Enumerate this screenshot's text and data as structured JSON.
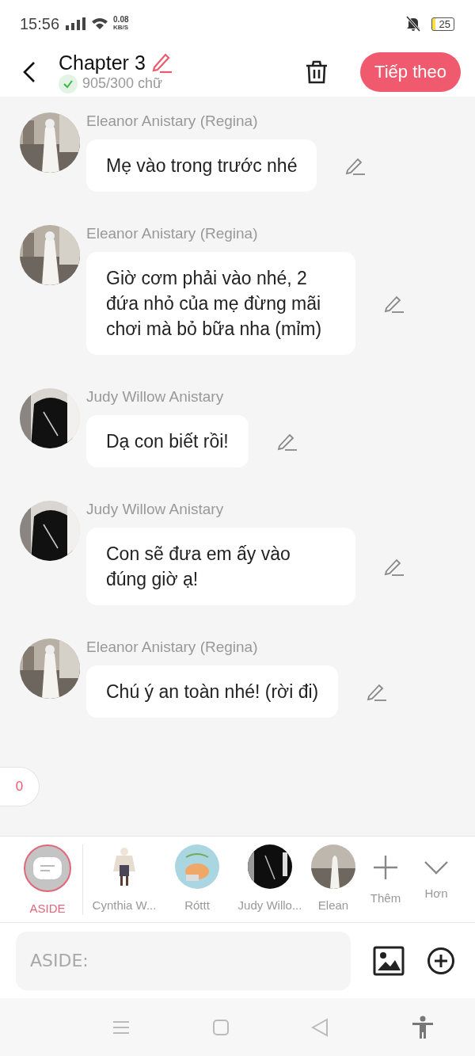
{
  "status_bar": {
    "time": "15:56",
    "speed_value": "0.08",
    "speed_unit": "KB/S",
    "battery": "25"
  },
  "header": {
    "title": "Chapter 3",
    "word_count": "905/300 chữ",
    "goal_met": true,
    "next_button": "Tiếp theo"
  },
  "messages": [
    {
      "sender": "Eleanor Anistary (Regina)",
      "text": "Mẹ vào trong trước nhé"
    },
    {
      "sender": "Eleanor Anistary (Regina)",
      "text": "Giờ cơm phải vào nhé, 2 đứa nhỏ của mẹ đừng mãi chơi mà bỏ bữa nha (mỉm)"
    },
    {
      "sender": "Judy Willow Anistary",
      "text": "Dạ con biết rồi!"
    },
    {
      "sender": "Judy Willow Anistary",
      "text": "Con sẽ đưa em ấy vào đúng giờ ạ!"
    },
    {
      "sender": "Eleanor Anistary (Regina)",
      "text": "Chú ý an toàn nhé! (rời đi)"
    }
  ],
  "side_badge": "0",
  "characters": [
    {
      "name": "ASIDE",
      "kind": "aside",
      "selected": true
    },
    {
      "name": "Cynthia W...",
      "kind": "figure",
      "selected": false
    },
    {
      "name": "Róttt",
      "kind": "cat",
      "selected": false
    },
    {
      "name": "Judy Willo...",
      "kind": "dark",
      "selected": false
    },
    {
      "name": "Elean",
      "kind": "light",
      "selected": false
    }
  ],
  "character_actions": [
    {
      "label": "Thêm",
      "kind": "add"
    },
    {
      "label": "Hơn",
      "kind": "more"
    }
  ],
  "input": {
    "placeholder": "ASIDE:"
  }
}
